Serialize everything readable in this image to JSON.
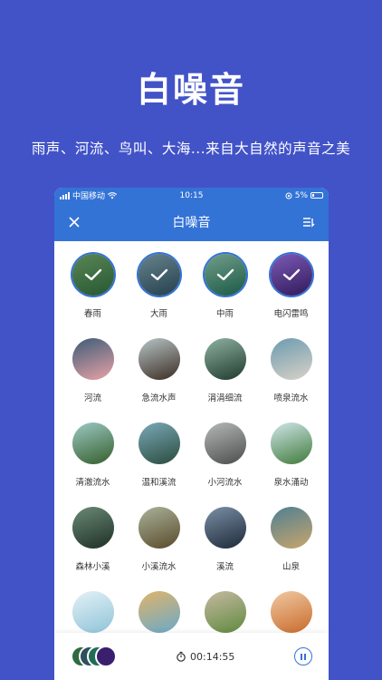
{
  "promo": {
    "title": "白噪音",
    "subtitle": "雨声、河流、鸟叫、大海...来自大自然的声音之美"
  },
  "status_bar": {
    "carrier": "中国移动",
    "time": "10:15",
    "battery": "5%"
  },
  "navbar": {
    "title": "白噪音",
    "left_icon": "close-icon",
    "right_icon": "playlist-icon"
  },
  "sounds": [
    {
      "label": "春雨",
      "selected": true,
      "colors": [
        "#2f6b3d",
        "#6fa46a"
      ]
    },
    {
      "label": "大雨",
      "selected": true,
      "colors": [
        "#2d4f5e",
        "#7ea0ad"
      ]
    },
    {
      "label": "中雨",
      "selected": true,
      "colors": [
        "#1f6d55",
        "#8cc2aa"
      ]
    },
    {
      "label": "电闪雷鸣",
      "selected": true,
      "colors": [
        "#3a1f6e",
        "#9a6fe0"
      ]
    },
    {
      "label": "河流",
      "selected": false,
      "colors": [
        "#e8a3a6",
        "#3d5b78"
      ]
    },
    {
      "label": "急流水声",
      "selected": false,
      "colors": [
        "#3b2c22",
        "#b7c5c8"
      ]
    },
    {
      "label": "涓涓细流",
      "selected": false,
      "colors": [
        "#1f3a2d",
        "#8fb2a2"
      ]
    },
    {
      "label": "喷泉流水",
      "selected": false,
      "colors": [
        "#d9d2c7",
        "#6b9bb0"
      ]
    },
    {
      "label": "清澈流水",
      "selected": false,
      "colors": [
        "#355e2a",
        "#9cc9c6"
      ]
    },
    {
      "label": "温和溪流",
      "selected": false,
      "colors": [
        "#2a4b3e",
        "#7aa9b8"
      ]
    },
    {
      "label": "小河流水",
      "selected": false,
      "colors": [
        "#4b4d4d",
        "#b5b9b7"
      ]
    },
    {
      "label": "泉水涌动",
      "selected": false,
      "colors": [
        "#3f7a3a",
        "#d0e6ea"
      ]
    },
    {
      "label": "森林小溪",
      "selected": false,
      "colors": [
        "#1d2f24",
        "#6b8a77"
      ]
    },
    {
      "label": "小溪流水",
      "selected": false,
      "colors": [
        "#5a4a2b",
        "#a9b39a"
      ]
    },
    {
      "label": "溪流",
      "selected": false,
      "colors": [
        "#1c2a3a",
        "#7b8fa4"
      ]
    },
    {
      "label": "山泉",
      "selected": false,
      "colors": [
        "#c9a66b",
        "#4f7f92"
      ]
    },
    {
      "label": "",
      "selected": false,
      "colors": [
        "#8fc4d8",
        "#e4f1f6"
      ]
    },
    {
      "label": "",
      "selected": false,
      "colors": [
        "#6aa9c9",
        "#e0b46a"
      ]
    },
    {
      "label": "",
      "selected": false,
      "colors": [
        "#5f8a3e",
        "#c7b9a2"
      ]
    },
    {
      "label": "",
      "selected": false,
      "colors": [
        "#c96b2b",
        "#f0c9a3"
      ]
    }
  ],
  "player": {
    "timer": "00:14:55",
    "stack_colors": [
      "#2f6b3d",
      "#2d4f5e",
      "#1f6d55",
      "#3a1f6e"
    ],
    "timer_icon": "stopwatch-icon",
    "control_icon": "pause-icon"
  },
  "colors": {
    "background": "#4253c8",
    "accent": "#3473d6"
  }
}
